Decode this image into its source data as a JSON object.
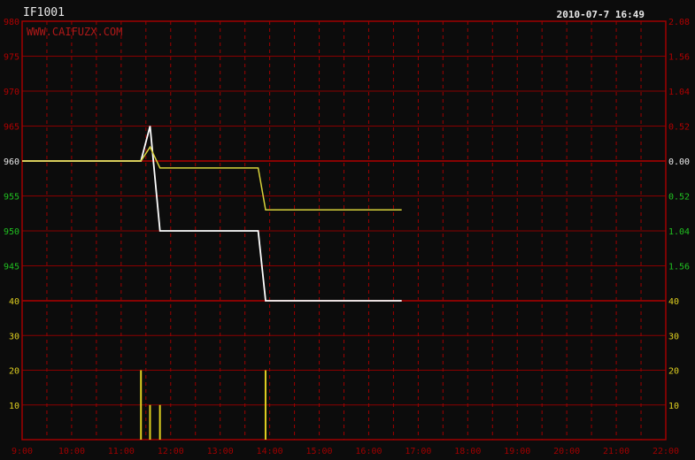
{
  "header": {
    "symbol": "IF1001",
    "datetime": "2010-07-7 16:49",
    "watermark": "WWW.CAIFUZX.COM"
  },
  "colors": {
    "background": "#0c0c0c",
    "border": "#a00000",
    "grid_solid": "#8a0000",
    "grid_dashed": "#a00000",
    "price_line": "#ffffff",
    "avg_line": "#d8d23a",
    "volume_bars": "#e0d020",
    "label_red": "#b00000",
    "label_green": "#20c020",
    "label_white": "#e8e8e8",
    "label_yellow": "#e0d020",
    "label_time": "#a00000",
    "watermark": "#b01818"
  },
  "chart_data": {
    "type": "line",
    "x_ticks": [
      "9:00",
      "10:00",
      "11:00",
      "12:00",
      "13:00",
      "14:00",
      "15:00",
      "16:00",
      "17:00",
      "18:00",
      "19:00",
      "20:00",
      "21:00",
      "22:00"
    ],
    "price_axis_left": [
      {
        "label": "980",
        "color": "red"
      },
      {
        "label": "975",
        "color": "red"
      },
      {
        "label": "970",
        "color": "red"
      },
      {
        "label": "965",
        "color": "red"
      },
      {
        "label": "960",
        "color": "white"
      },
      {
        "label": "955",
        "color": "green"
      },
      {
        "label": "950",
        "color": "green"
      },
      {
        "label": "945",
        "color": "green"
      }
    ],
    "price_axis_right": [
      {
        "label": "2.08",
        "color": "red"
      },
      {
        "label": "1.56",
        "color": "red"
      },
      {
        "label": "1.04",
        "color": "red"
      },
      {
        "label": "0.52",
        "color": "red"
      },
      {
        "label": "0.00",
        "color": "white"
      },
      {
        "label": "0.52",
        "color": "green"
      },
      {
        "label": "1.04",
        "color": "green"
      },
      {
        "label": "1.56",
        "color": "green"
      }
    ],
    "volume_axis_left": [
      "40",
      "30",
      "20",
      "10"
    ],
    "volume_axis_right": [
      "40",
      "30",
      "20",
      "10"
    ],
    "price_ylim": [
      940,
      980
    ],
    "volume_ylim": [
      0,
      40
    ],
    "xlim_hours": [
      9,
      22
    ],
    "series": [
      {
        "kind": "price",
        "points": [
          [
            "9:00",
            960
          ],
          [
            "11:24",
            960
          ],
          [
            "11:35",
            965
          ],
          [
            "11:47",
            950
          ],
          [
            "13:46",
            950
          ],
          [
            "13:55",
            940
          ],
          [
            "16:40",
            940
          ]
        ]
      },
      {
        "kind": "average",
        "points": [
          [
            "9:00",
            960
          ],
          [
            "11:24",
            960
          ],
          [
            "11:35",
            962
          ],
          [
            "11:47",
            959
          ],
          [
            "13:46",
            959
          ],
          [
            "13:55",
            953
          ],
          [
            "16:40",
            953
          ]
        ]
      }
    ],
    "volume": [
      {
        "time": "11:24",
        "value": 20
      },
      {
        "time": "11:35",
        "value": 10
      },
      {
        "time": "11:47",
        "value": 10
      },
      {
        "time": "13:55",
        "value": 20
      }
    ]
  }
}
